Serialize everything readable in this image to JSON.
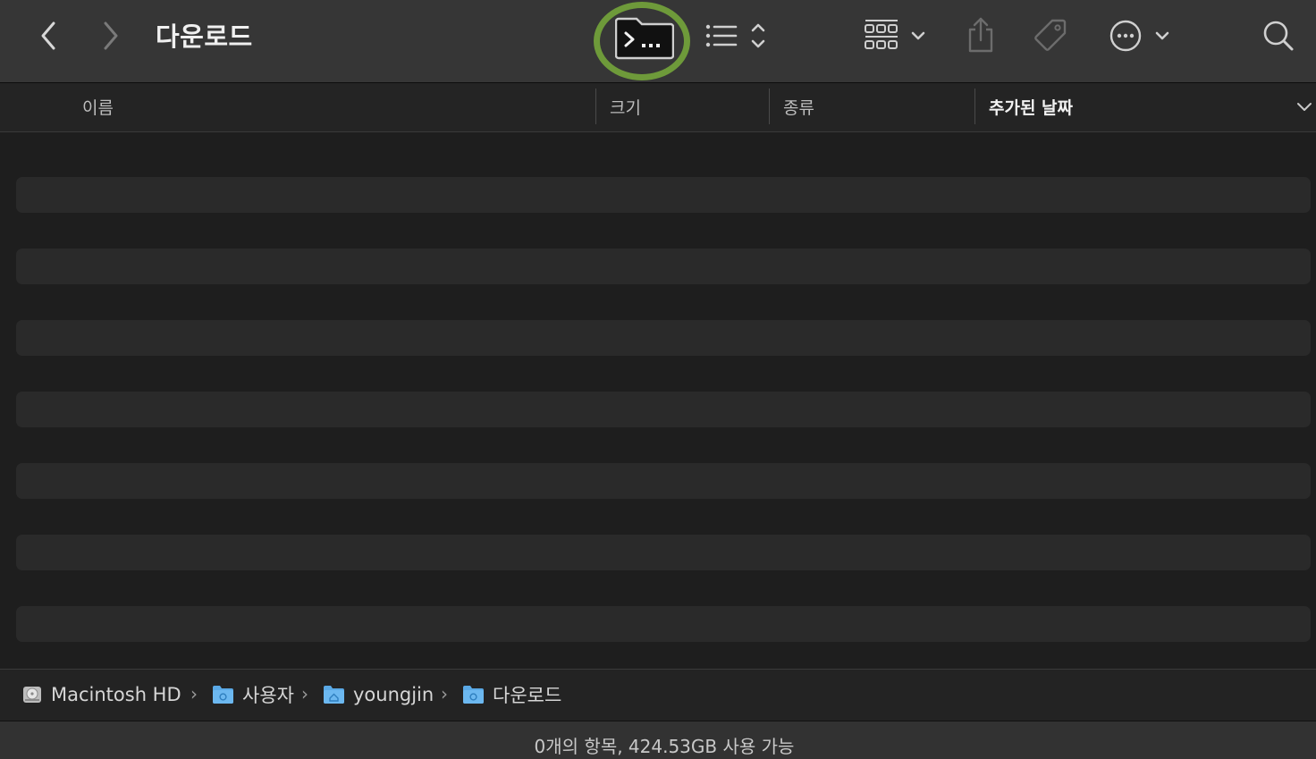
{
  "window": {
    "title": "다운로드"
  },
  "toolbar": {
    "back_icon": "chevron-left-icon",
    "forward_icon": "chevron-right-icon",
    "terminal_icon": "terminal-folder-icon",
    "view_list_icon": "list-view-icon",
    "group_icon": "grid-group-icon",
    "share_icon": "share-icon",
    "tag_icon": "tag-icon",
    "more_icon": "ellipsis-circle-icon",
    "search_icon": "search-icon",
    "highlight_color": "#6e9a3a"
  },
  "columns": [
    {
      "label": "이름"
    },
    {
      "label": "크기"
    },
    {
      "label": "종류"
    },
    {
      "label": "추가된 날짜"
    }
  ],
  "pathbar": {
    "items": [
      {
        "label": "Macintosh HD",
        "icon": "hard-drive-icon"
      },
      {
        "label": "사용자",
        "icon": "folder-icon"
      },
      {
        "label": "youngjin",
        "icon": "home-folder-icon"
      },
      {
        "label": "다운로드",
        "icon": "downloads-folder-icon"
      }
    ]
  },
  "status": {
    "text": "0개의 항목, 424.53GB 사용 가능"
  },
  "colors": {
    "accent_folder": "#5aa9e6"
  }
}
